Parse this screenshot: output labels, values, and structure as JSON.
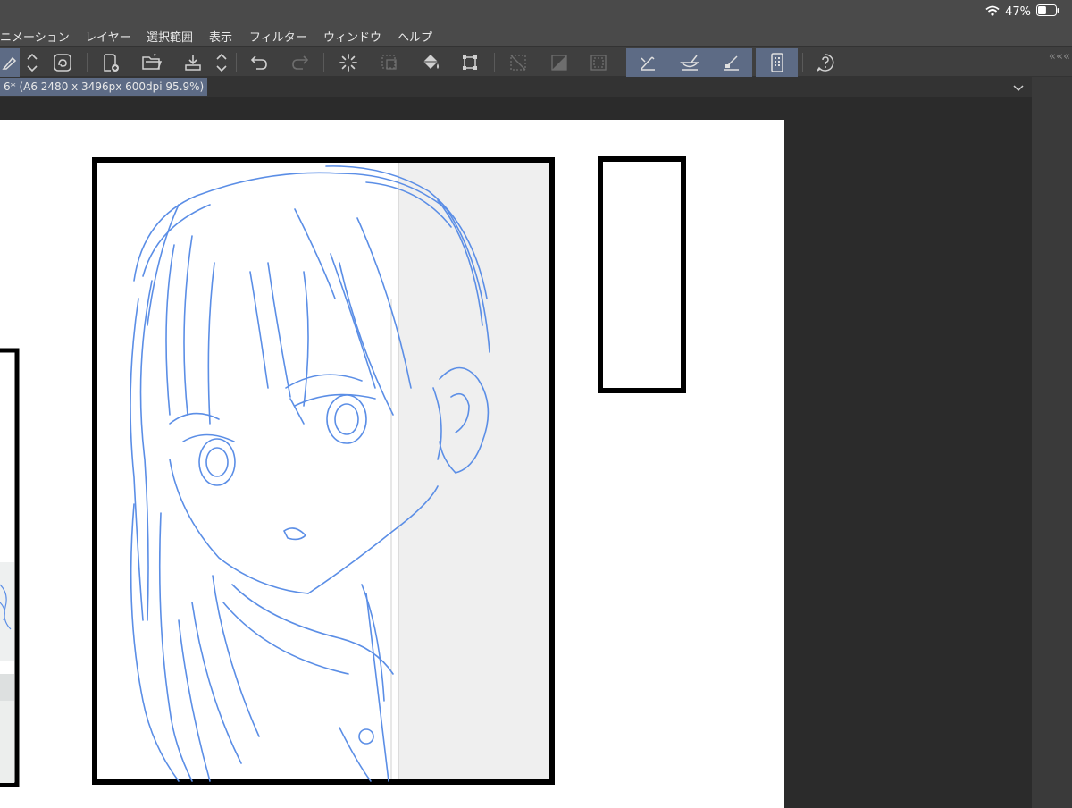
{
  "status": {
    "battery_percent": "47%",
    "battery_level": 0.47,
    "wifi_icon": "wifi-icon",
    "battery_icon": "battery-icon"
  },
  "menu": {
    "items": [
      {
        "label": "ニメーション"
      },
      {
        "label": "レイヤー"
      },
      {
        "label": "選択範囲"
      },
      {
        "label": "表示"
      },
      {
        "label": "フィルター"
      },
      {
        "label": "ウィンドウ"
      },
      {
        "label": "ヘルプ"
      }
    ]
  },
  "toolbar": {
    "buttons": [
      "menu-icon",
      "updown-icon",
      "cloud-sync-icon",
      "new-page-icon",
      "open-folder-icon",
      "save-download-icon",
      "updown-icon",
      "undo-icon",
      "redo-icon",
      "loading-spinner-icon",
      "select-all-icon",
      "fill-bucket-icon",
      "transform-icon",
      "clear-outside-icon",
      "tone-area-icon",
      "selection-frame-icon",
      "pen-tool-icon",
      "brush-tool-icon",
      "eraser-tool-icon",
      "device-icon",
      "help-icon"
    ]
  },
  "document": {
    "tab_title": "6* (A6 2480 x 3496px 600dpi 95.9%)"
  },
  "colors": {
    "ui_dark": "#2b2b2b",
    "menubar": "#4a4a4a",
    "toolbar": "#3f3f3f",
    "active_tab": "#5d6b85",
    "sketch_blue": "#5b8ee6",
    "panel_border": "#000000"
  }
}
